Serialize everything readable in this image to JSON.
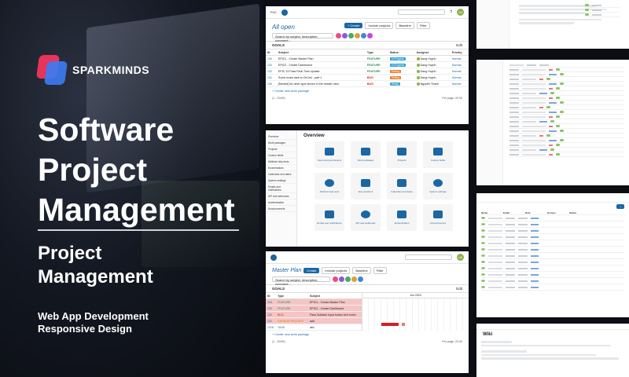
{
  "brand": {
    "name": "SPARKMINDS",
    "colors": {
      "red": "#e8335a",
      "blue": "#3d7bf0"
    }
  },
  "hero": {
    "title_lines": [
      "Software",
      "Project",
      "Management"
    ],
    "subtitle_lines": [
      "Project",
      "Management"
    ],
    "tags": [
      "Web App Development",
      "Responsive Design"
    ]
  },
  "work_packages": {
    "project": "PoC",
    "title": "All open",
    "search_placeholder": "Search by subject, description, comment...",
    "create_label": "+ Create",
    "include_label": "Include projects",
    "baseline_label": "Baseline",
    "filter_label": "Filter",
    "goals_label": "GOALS",
    "edit_label": "Edit",
    "columns": [
      "ID",
      "Subject",
      "Type",
      "Status",
      "Assignee",
      "Priority"
    ],
    "rows": [
      {
        "id": "134",
        "subject": "EPIC1 - Create Master Plan",
        "type": "FEATURE",
        "status": "In Progress",
        "assignee": "Dang Huynh",
        "priority": "Normal"
      },
      {
        "id": "133",
        "subject": "EPIC2 - Create Dashboard",
        "type": "FEATURE",
        "status": "In Progress",
        "assignee": "Dang Huynh",
        "priority": "Normal"
      },
      {
        "id": "132",
        "subject": "EPIC 13 Pass Final Time Update",
        "type": "FEATURE",
        "status": "Testing",
        "assignee": "Dang Huynh",
        "priority": "Normal"
      },
      {
        "id": "131",
        "subject": "Some exam task to Ctrl-list - part 1",
        "type": "BUG",
        "status": "Testing",
        "assignee": "Dang Huynh",
        "priority": "Normal"
      },
      {
        "id": "130",
        "subject": "[Newbit] No other type shown in the header view",
        "type": "BUG",
        "status": "Ready",
        "assignee": "Nguyễn Thanh",
        "priority": "Normal"
      }
    ],
    "create_new": "+ Create new work package",
    "pagination": "(1 - 20/45)",
    "per_page": "Per page: 20  50"
  },
  "overview": {
    "title": "Overview",
    "sidebar": [
      "Overview",
      "Work packages",
      "Projects",
      "Custom fields",
      "Attribute help texts",
      "Enumerations",
      "Calendars and dates",
      "System settings",
      "Emails and notifications",
      "API and webhooks",
      "Authentication",
      "Announcement"
    ],
    "tiles": [
      "Users and permissions",
      "Work packages",
      "Projects",
      "Custom fields",
      "Attribute help texts",
      "Enumerations",
      "Calendars and dates",
      "System settings",
      "Emails and notifications",
      "API and webhooks",
      "Authentication",
      "Announcement"
    ]
  },
  "master_plan": {
    "title": "Master Plan",
    "search_placeholder": "Search by subject, description, comment...",
    "create_label": "Create",
    "include_label": "Include projects",
    "baseline_label": "Baseline",
    "filter_label": "Filter",
    "goals_label": "GOALS",
    "edit_label": "Edit",
    "columns": [
      "ID",
      "Type",
      "Subject"
    ],
    "rows": [
      {
        "id": "134",
        "type": "FEATURE",
        "subject": "EPIC1 - Create Master Plan"
      },
      {
        "id": "133",
        "type": "FEATURE",
        "subject": "EPIC2 - Create Dashboard"
      },
      {
        "id": "132",
        "type": "BUG",
        "subject": "Pass Subtask Input button text exam"
      },
      {
        "id": "131",
        "type": "CHANGE REQUEST",
        "subject": "add"
      },
      {
        "id": "1316",
        "type": "TASK",
        "subject": "abc"
      }
    ],
    "create_new": "+ Create new work package",
    "pagination": "(1 - 20/45)",
    "per_page": "Per page: 20  50",
    "month": "Jun 2024"
  },
  "users": {
    "columns": [
      "Name",
      "Email",
      "Role",
      "Groups",
      "Status"
    ]
  },
  "wiki": {
    "title": "Wiki"
  },
  "colors": {
    "primary": "#1a67a3",
    "feature": "#2e8b57",
    "bug": "#d61f1f",
    "change_request": "#e07a00",
    "in_progress": "#2aa1d6",
    "testing": "#f07c2b",
    "ready": "#3aa0c9"
  }
}
